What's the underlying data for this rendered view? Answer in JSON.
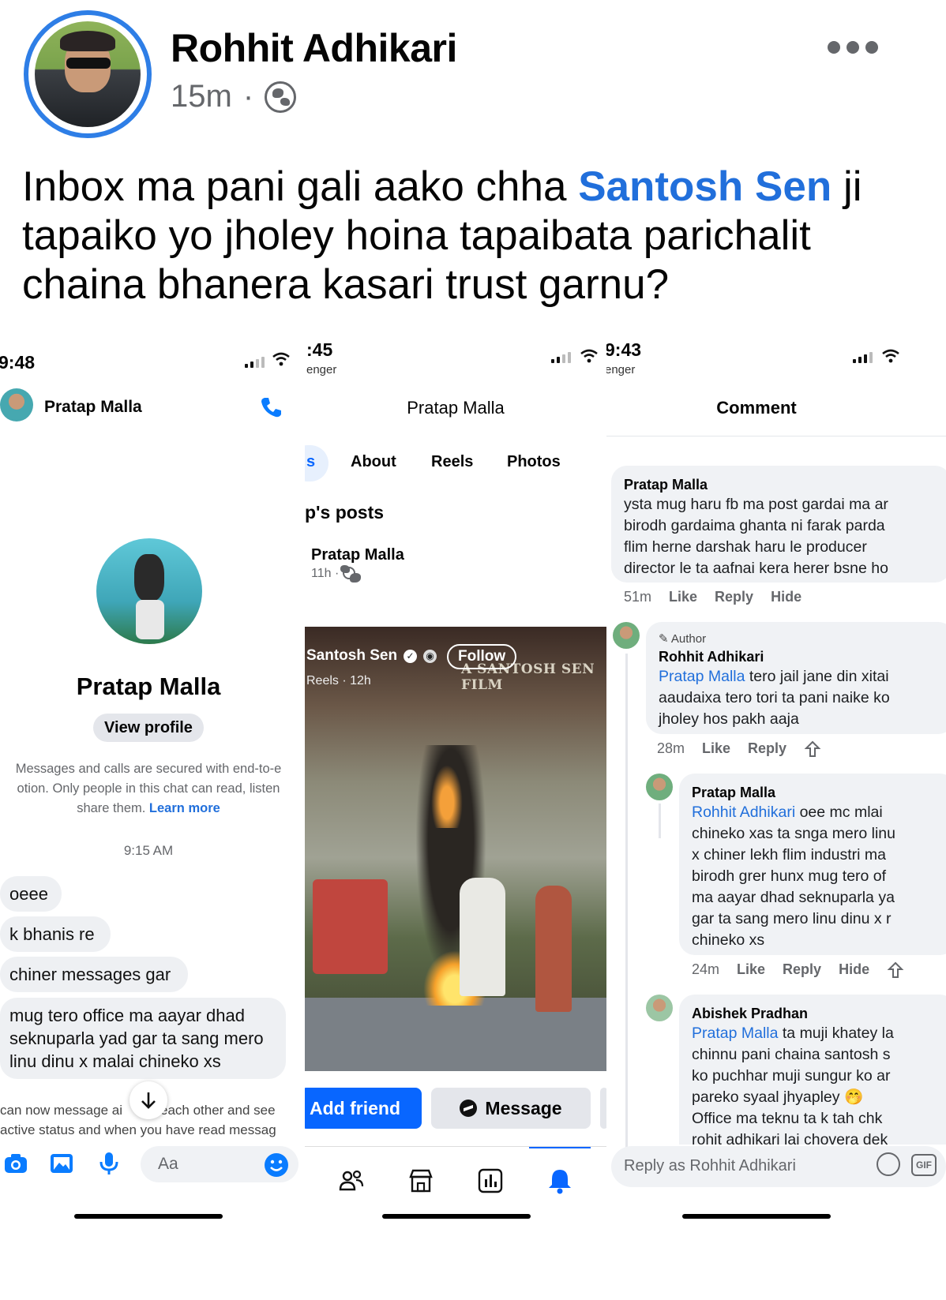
{
  "post": {
    "author": "Rohhit Adhikari",
    "time": "15m",
    "separator": "·",
    "text_before": "Inbox ma pani gali aako chha ",
    "mention": "Santosh Sen",
    "text_after_line1": " ji",
    "text_line2": "tapaiko yo jholey hoina tapaibata parichalit",
    "text_line3": "chaina bhanera kasari trust garnu?"
  },
  "panel1": {
    "time": "9:48",
    "header_name": "Pratap Malla",
    "profile_name": "Pratap Malla",
    "view_profile": "View profile",
    "enc_line1": "Messages and calls are secured with end-to-e",
    "enc_line2": "otion. Only people in this chat can read, listen",
    "enc_line3": "share them.",
    "learn_more": "Learn more",
    "chat_time": "9:15 AM",
    "messages": [
      "oeee",
      "k bhanis re",
      "chiner messages gar",
      "mug tero office ma aayar dhad",
      "seknuparla yad gar ta sang mero",
      "linu dinu x malai chineko xs"
    ],
    "active_line1_a": "can now message ai",
    "active_line1_b": "each other and see",
    "active_line2": "active status and when you have read messag",
    "composer_placeholder": "Aa"
  },
  "panel2": {
    "time": ":45",
    "sub": "enger",
    "title": "Pratap Malla",
    "tab_partial": "s",
    "tabs": [
      "About",
      "Reels",
      "Photos"
    ],
    "posts_heading": "p's posts",
    "post_author": "Pratap Malla",
    "post_meta": "11h ·",
    "reel_author": "Santosh Sen",
    "reel_follow": "Follow",
    "reel_meta": "Reels · 12h",
    "reel_watermark": "A SANTOSH SEN FILM",
    "add_friend": "Add friend",
    "message": "Message"
  },
  "panel3": {
    "time": "9:43",
    "sub": "enger",
    "title": "Comment",
    "c1": {
      "author": "Pratap Malla",
      "lines": [
        "ysta mug haru fb ma post gardai ma ar",
        "birodh gardaima ghanta ni farak parda",
        "flim herne darshak haru le producer",
        "director le ta aafnai kera herer bsne ho"
      ],
      "time": "51m",
      "like": "Like",
      "reply": "Reply",
      "hide": "Hide"
    },
    "c2": {
      "badge": "Author",
      "author": "Rohhit Adhikari",
      "tag": "Pratap Malla",
      "line1_rest": " tero jail jane din xitai",
      "lines": [
        "aaudaixa tero tori ta pani naike ko",
        "jholey hos pakh aaja"
      ],
      "time": "28m",
      "like": "Like",
      "reply": "Reply"
    },
    "c3": {
      "author": "Pratap Malla",
      "tag": "Rohhit Adhikari",
      "line1_rest": " oee mc mlai",
      "lines": [
        "chineko xas ta snga mero linu",
        "x chiner lekh flim industri ma",
        "birodh grer hunx mug tero of",
        "ma aayar dhad seknuparla ya",
        "gar ta sang mero linu dinu x r",
        "chineko xs"
      ],
      "time": "24m",
      "like": "Like",
      "reply": "Reply",
      "hide": "Hide"
    },
    "c4": {
      "author": "Abishek Pradhan",
      "tag": "Pratap Malla",
      "line1_rest": " ta muji khatey la",
      "lines": [
        "chinnu pani chaina  santosh s",
        "ko puchhar muji sungur ko ar",
        "pareko syaal jhyapley 🤭",
        "Office ma teknu ta k tah  chk",
        "rohit adhikari lai chovera  dek"
      ]
    },
    "reply_placeholder": "Reply as Rohhit Adhikari",
    "gif": "GIF"
  },
  "colors": {
    "accent": "#216fdb",
    "messenger_blue": "#0866ff"
  }
}
